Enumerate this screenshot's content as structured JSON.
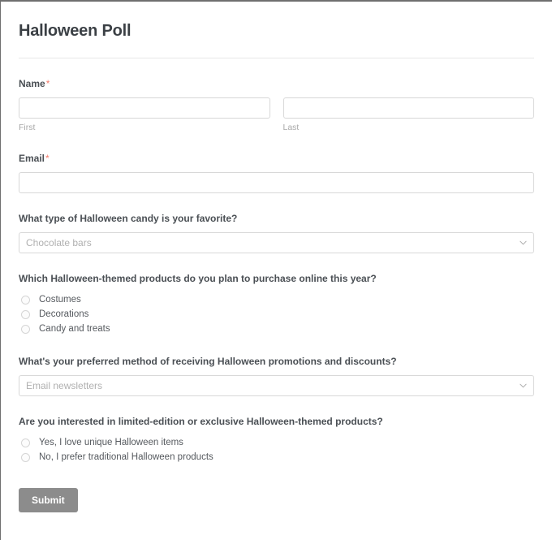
{
  "form": {
    "title": "Halloween Poll",
    "required_marker": "*",
    "fields": {
      "name": {
        "label": "Name",
        "first": {
          "value": "",
          "placeholder": "",
          "sublabel": "First"
        },
        "last": {
          "value": "",
          "placeholder": "",
          "sublabel": "Last"
        }
      },
      "email": {
        "label": "Email",
        "value": "",
        "placeholder": ""
      }
    },
    "questions": [
      {
        "label": "What type of Halloween candy is your favorite?",
        "type": "select",
        "selected": "Chocolate bars",
        "chevron_icon": "chevron-down-icon"
      },
      {
        "label": "Which Halloween-themed products do you plan to purchase online this year?",
        "type": "radio",
        "options": [
          "Costumes",
          "Decorations",
          "Candy and treats"
        ]
      },
      {
        "label": "What's your preferred method of receiving Halloween promotions and discounts?",
        "type": "select",
        "selected": "Email newsletters",
        "chevron_icon": "chevron-down-icon"
      },
      {
        "label": "Are you interested in limited-edition or exclusive Halloween-themed products?",
        "type": "radio",
        "options": [
          "Yes, I love unique Halloween items",
          "No, I prefer traditional Halloween products"
        ]
      }
    ],
    "submit_label": "Submit"
  },
  "colors": {
    "title": "#3b4045",
    "label": "#4a4f54",
    "required": "#f47c6c",
    "placeholder": "#b0b0b0",
    "sublabel": "#a8a8a8",
    "input_border": "#d8d8d8",
    "submit_bg": "#8c8c8c",
    "divider": "#e8e8e8"
  }
}
